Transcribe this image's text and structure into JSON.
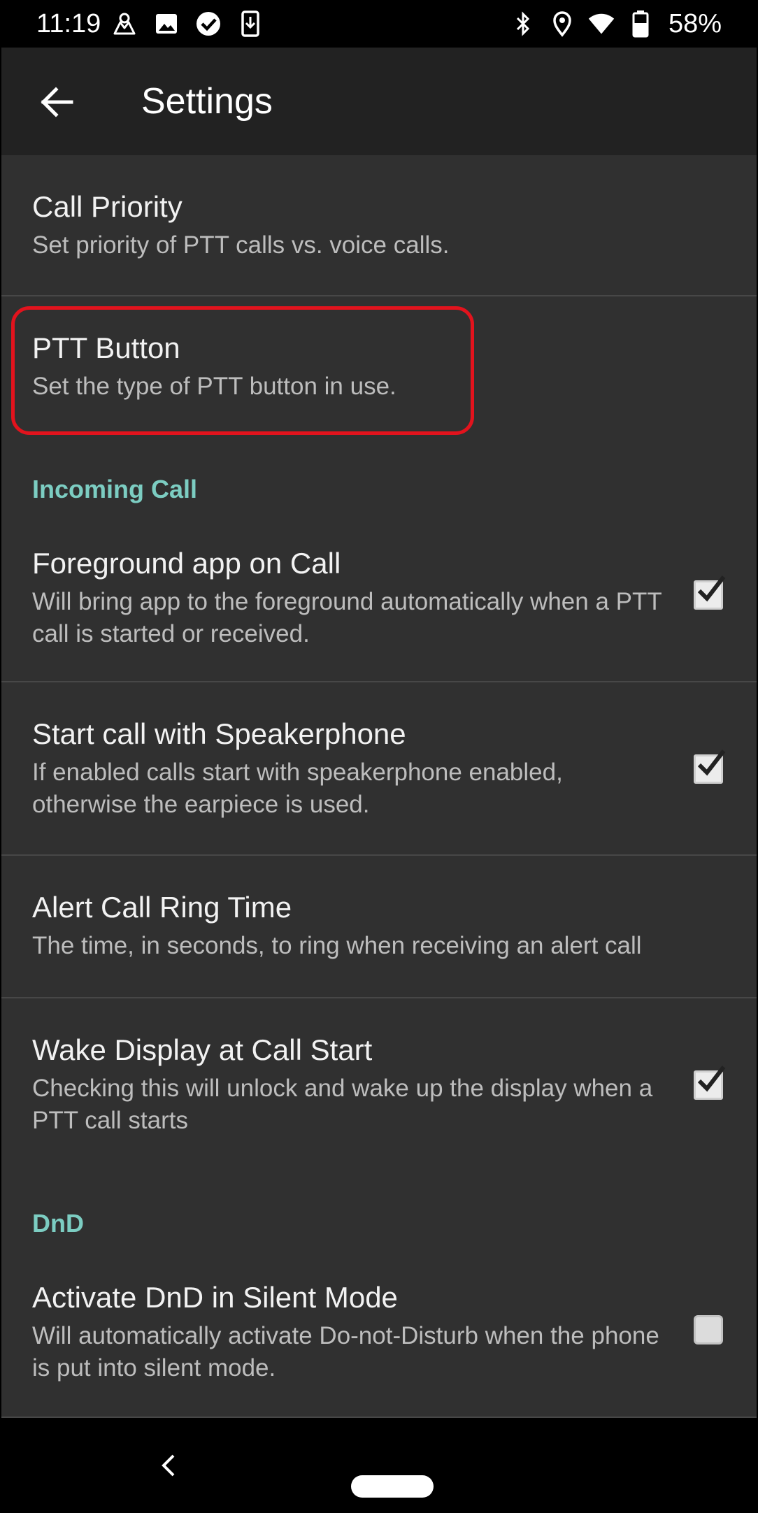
{
  "status_bar": {
    "time": "11:19",
    "battery_percent": "58%",
    "left_icons": [
      "app-notification-icon",
      "gallery-icon",
      "check-circle-icon",
      "phone-download-icon"
    ],
    "right_icons": [
      "bluetooth-icon",
      "location-icon",
      "wifi-icon",
      "battery-icon"
    ]
  },
  "app_bar": {
    "title": "Settings"
  },
  "preferences": {
    "call_priority": {
      "title": "Call Priority",
      "summary": "Set priority of PTT calls vs. voice calls."
    },
    "ptt_button": {
      "title": "PTT Button",
      "summary": "Set the type of PTT button in use."
    },
    "incoming_call_header": "Incoming Call",
    "foreground_app": {
      "title": "Foreground app on Call",
      "summary": "Will bring app to the foreground automatically when a PTT call is started or received.",
      "checked": true
    },
    "speakerphone": {
      "title": "Start call with Speakerphone",
      "summary": "If enabled calls start with speakerphone enabled, otherwise the earpiece is used.",
      "checked": true
    },
    "alert_ring_time": {
      "title": "Alert Call Ring Time",
      "summary": "The time, in seconds, to ring when receiving an alert call"
    },
    "wake_display": {
      "title": "Wake Display at Call Start",
      "summary": "Checking this will unlock and wake up the display when a PTT call starts",
      "checked": true
    },
    "dnd_header": "DnD",
    "activate_dnd": {
      "title": "Activate DnD in Silent Mode",
      "summary": "Will automatically activate Do-not-Disturb when the phone is put into silent mode.",
      "checked": false
    }
  },
  "colors": {
    "accent": "#7ccdc2",
    "highlight": "#e2131d",
    "background": "#303030",
    "app_bar": "#222222"
  }
}
